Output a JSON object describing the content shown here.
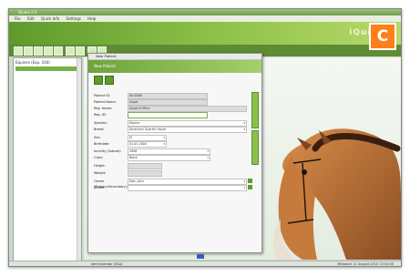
{
  "window": {
    "title": "iQuine 2.0"
  },
  "menu": [
    "File",
    "Edit",
    "Quick Info",
    "Settings",
    "Help"
  ],
  "brand": "iQuine",
  "sidebar": {
    "header": "Equines (Exp. 104)",
    "selected_item": "New Patient"
  },
  "dialog": {
    "title": "New Patient",
    "header": "New Patient",
    "side_tabs": [
      "Patient Details",
      "Patient Images"
    ],
    "fields": [
      {
        "label": "Patient ID:",
        "value": "00-0000"
      },
      {
        "label": "Patient Name:",
        "value": "Angel"
      },
      {
        "label": "Reg. Name:",
        "value": "Angel of Mine"
      },
      {
        "label": "Reg. ID:",
        "value": ""
      },
      {
        "label": "Species:",
        "value": "Equine"
      },
      {
        "label": "Breed:",
        "value": "American Quarter Horse"
      },
      {
        "label": "Sex:",
        "value": "M"
      },
      {
        "label": "Birthdate:",
        "value": "01.01.2004"
      },
      {
        "label": "Activity (Subcat):",
        "value": "2008"
      },
      {
        "label": "Color:",
        "value": "Black"
      },
      {
        "label": "Height:",
        "value": ""
      },
      {
        "label": "Weight:",
        "value": ""
      },
      {
        "label": "Owner (Primary/Secondary):",
        "value": "Doe, John"
      },
      {
        "label": "Stable:",
        "value": ""
      }
    ]
  },
  "statusbar": {
    "left": "administrator (SSA)",
    "right": "Mittwoch 11 August 2010 13:54:00"
  },
  "corner_badge": "C",
  "colors": {
    "accent": "#78b04a",
    "badge": "#ff7f1a"
  }
}
